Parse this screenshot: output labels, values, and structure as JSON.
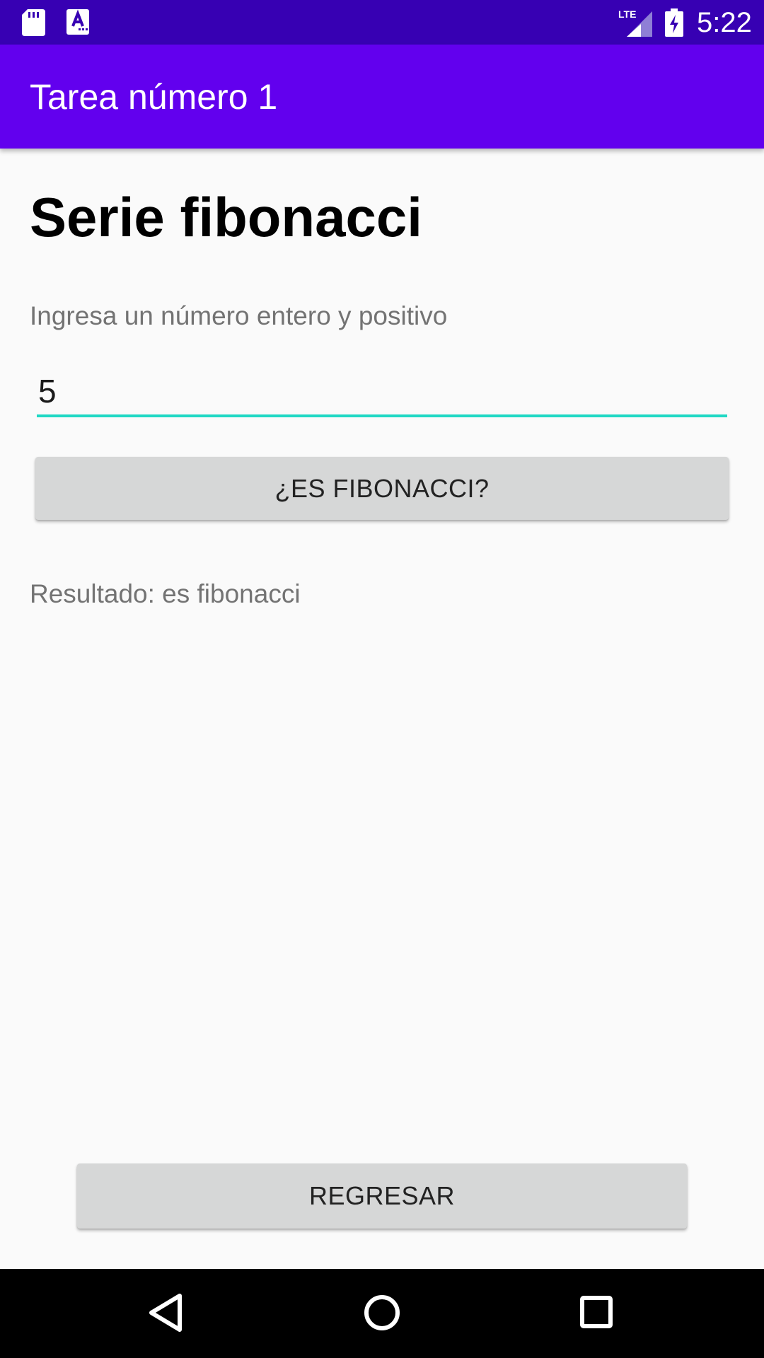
{
  "status_bar": {
    "time": "5:22",
    "network": "LTE",
    "icons": [
      "sd-card-icon",
      "a-notification-icon",
      "lte-signal-icon",
      "battery-charging-icon"
    ]
  },
  "app_bar": {
    "title": "Tarea número 1"
  },
  "main": {
    "heading": "Serie fibonacci",
    "prompt": "Ingresa un número entero y positivo",
    "number_input": {
      "value": "5",
      "underline_color": "#1fd8c4"
    },
    "check_button_label": "¿ES FIBONACCI?",
    "result_text": "Resultado: es fibonacci",
    "back_button_label": "REGRESAR"
  },
  "nav_bar": {
    "icons": [
      "back-icon",
      "home-icon",
      "recents-icon"
    ]
  },
  "colors": {
    "status_bar": "#3700b3",
    "app_bar": "#6200ee",
    "background": "#fafafa",
    "button": "#d6d7d7",
    "accent": "#1fd8c4"
  }
}
